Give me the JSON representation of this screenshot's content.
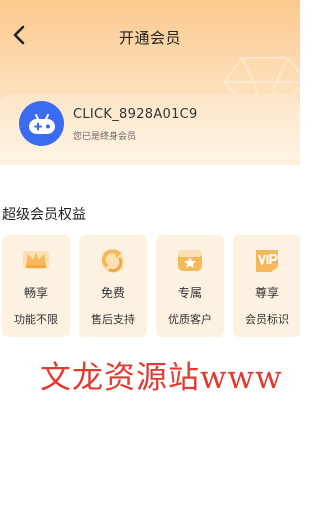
{
  "header": {
    "title": "开通会员"
  },
  "user": {
    "name": "CLICK_8928A01C9",
    "status": "您已是终身会员"
  },
  "benefits_section": {
    "title": "超级会员权益",
    "items": [
      {
        "name": "畅享",
        "desc": "功能不限",
        "icon": "crown-icon"
      },
      {
        "name": "免费",
        "desc": "售后支持",
        "icon": "refresh-arrow-icon"
      },
      {
        "name": "专属",
        "desc": "优质客户",
        "icon": "star-badge-icon"
      },
      {
        "name": "尊享",
        "desc": "会员标识",
        "icon": "vip-icon"
      }
    ]
  },
  "watermark": {
    "text": "文龙资源站www"
  },
  "colors": {
    "header_gradient_top": "#fbc98e",
    "avatar_bg": "#3b6cf0",
    "card_bg": "#fdf2e1",
    "icon_accent": "#f5b85a",
    "watermark": "#e23a2f"
  }
}
